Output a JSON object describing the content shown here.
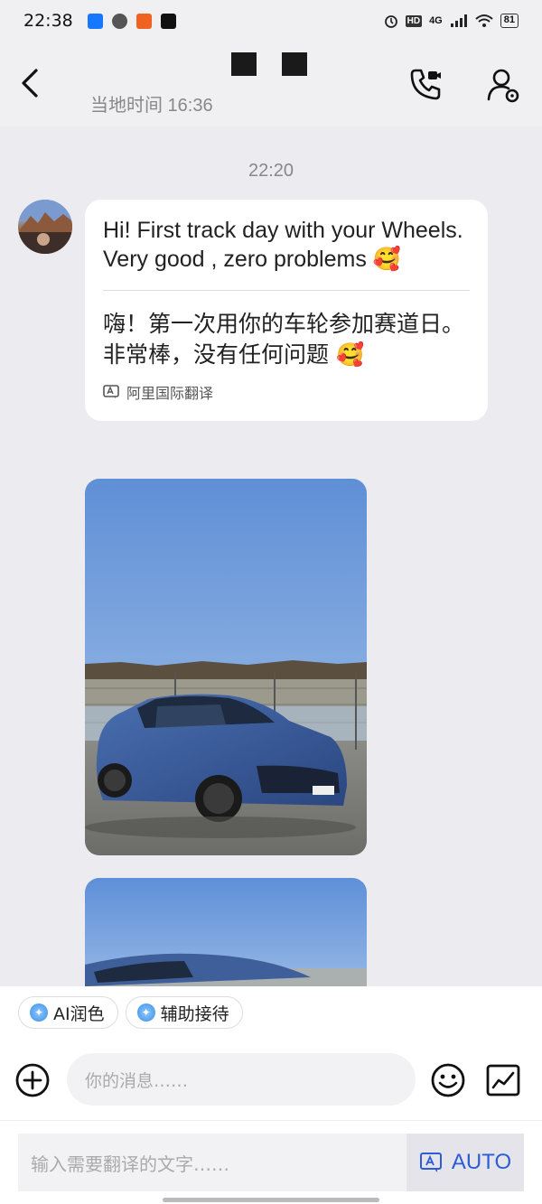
{
  "status_bar": {
    "time": "22:38",
    "network": "4G",
    "hd_label": "HD",
    "battery": "81",
    "app_icons": [
      "alipay-icon",
      "wechat-icon",
      "taobao-icon",
      "tiktok-icon"
    ]
  },
  "header": {
    "back_icon": "chevron-left-icon",
    "local_time": "当地时间 16:36",
    "call_icon": "phone-video-icon",
    "profile_icon": "user-settings-icon"
  },
  "chat": {
    "timestamp": "22:20",
    "message": {
      "original": "Hi! First track day with your Wheels. Very good , zero problems 🥰",
      "translated": "嗨！第一次用你的车轮参加赛道日。非常棒，没有任何问题 🥰",
      "translator": "阿里国际翻译",
      "translator_icon": "translate-icon"
    },
    "photos": [
      "blue-hatchback-car-photo",
      "blue-car-partial-photo"
    ]
  },
  "chips": [
    {
      "label": "AI润色",
      "icon": "ai-sparkle-icon"
    },
    {
      "label": "辅助接待",
      "icon": "ai-sparkle-icon"
    }
  ],
  "composer": {
    "placeholder": "你的消息……",
    "plus_icon": "plus-circle-icon",
    "emoji_icon": "smiley-icon",
    "expand_icon": "expand-icon"
  },
  "translate_bar": {
    "placeholder": "输入需要翻译的文字……",
    "auto_label": "AUTO",
    "auto_icon": "translate-icon"
  },
  "colors": {
    "background": "#ebebf0",
    "accent": "#2d5dd6",
    "bubble": "#ffffff"
  }
}
